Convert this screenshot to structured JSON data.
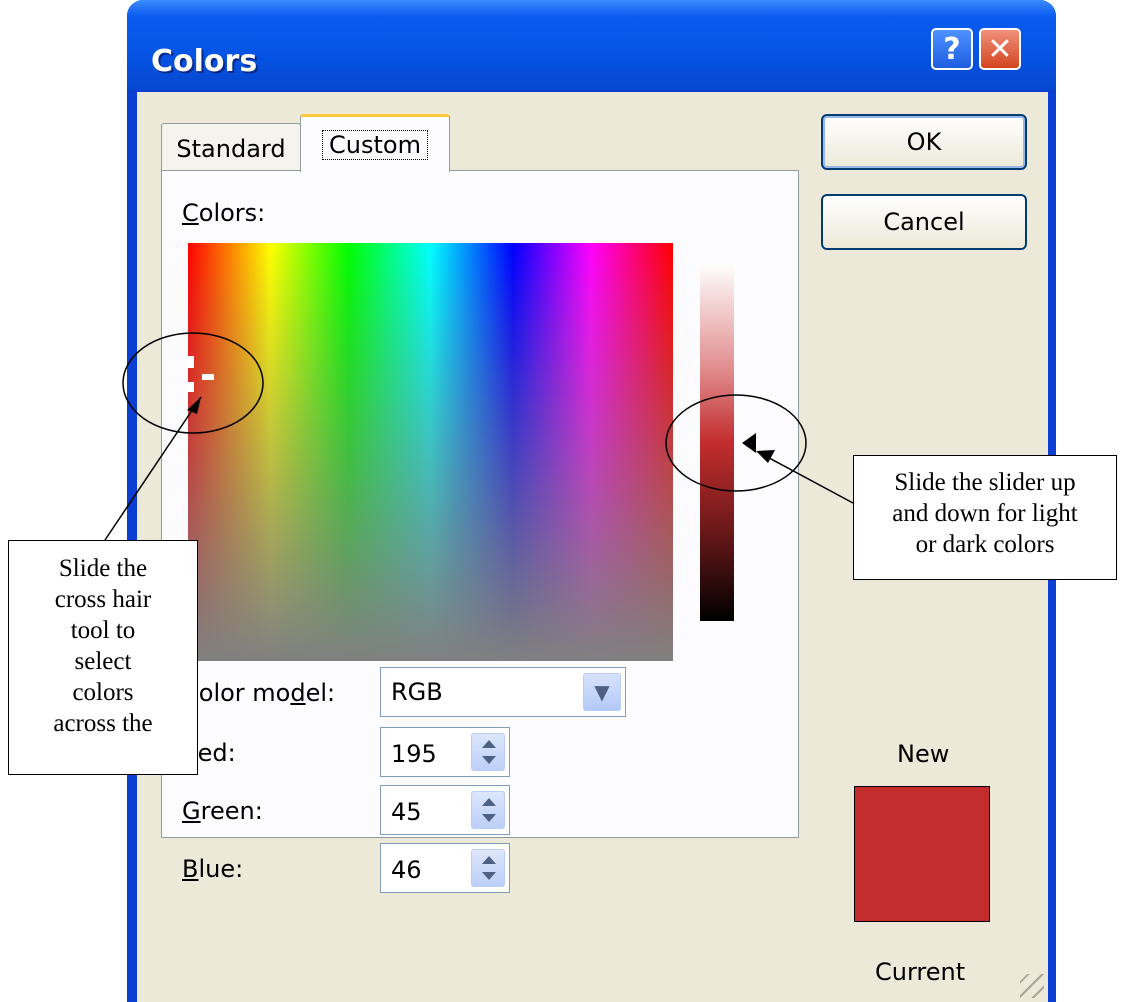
{
  "window": {
    "title": "Colors",
    "help_glyph": "?",
    "close_glyph": "✕"
  },
  "tabs": [
    {
      "label": "Standard",
      "active": false
    },
    {
      "label": "Custom",
      "active": true
    }
  ],
  "colors_label": {
    "accel": "C",
    "rest": "olors:"
  },
  "color_model": {
    "label_pre": "Color mo",
    "label_accel": "d",
    "label_post": "el:",
    "value": "RGB"
  },
  "red": {
    "label_accel": "R",
    "label_rest": "ed:",
    "value": "195"
  },
  "green": {
    "label_accel": "G",
    "label_rest": "reen:",
    "value": "45"
  },
  "blue": {
    "label_accel": "B",
    "label_rest": "lue:",
    "value": "46"
  },
  "buttons": {
    "ok": "OK",
    "cancel": "Cancel"
  },
  "preview": {
    "new_label": "New",
    "current_label": "Current",
    "color": "#c32d2e"
  },
  "annotations": {
    "left_lines": [
      "Slide the",
      "cross hair",
      "tool to",
      "select",
      "colors",
      "across the"
    ],
    "right_lines": [
      "Slide the slider up",
      "and down for light",
      "or dark colors"
    ]
  },
  "icons": [
    "help-icon",
    "close-icon",
    "dropdown-arrow-icon",
    "spin-arrows-icon",
    "slider-arrow-icon",
    "crosshair-icon",
    "resize-grip-icon"
  ]
}
